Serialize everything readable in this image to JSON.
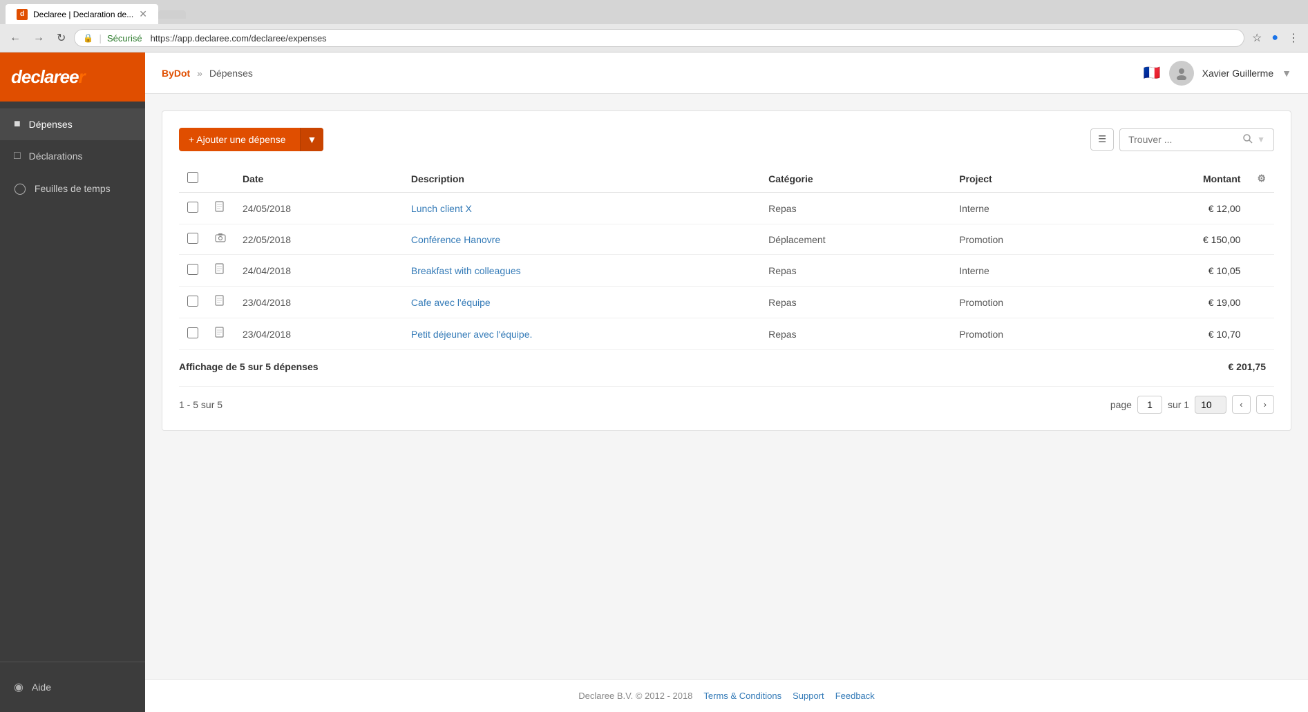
{
  "browser": {
    "tab_title": "Declaree | Declaration de...",
    "url": "https://app.declaree.com/declaree/expenses",
    "secure_label": "Sécurisé"
  },
  "sidebar": {
    "logo": "declaree",
    "items": [
      {
        "id": "depenses",
        "label": "Dépenses",
        "icon": "📄",
        "active": true
      },
      {
        "id": "declarations",
        "label": "Déclarations",
        "icon": "📋",
        "active": false
      },
      {
        "id": "feuilles",
        "label": "Feuilles de temps",
        "icon": "🕐",
        "active": false
      }
    ],
    "bottom_items": [
      {
        "id": "aide",
        "label": "Aide",
        "icon": "🌐"
      }
    ]
  },
  "header": {
    "org": "ByDot",
    "separator": "»",
    "page": "Dépenses",
    "user_name": "Xavier Guillerme",
    "flag": "🇫🇷"
  },
  "toolbar": {
    "add_button_label": "+ Ajouter une dépense",
    "search_placeholder": "Trouver ..."
  },
  "table": {
    "columns": [
      {
        "id": "checkbox",
        "label": ""
      },
      {
        "id": "receipt",
        "label": ""
      },
      {
        "id": "date",
        "label": "Date"
      },
      {
        "id": "description",
        "label": "Description"
      },
      {
        "id": "categorie",
        "label": "Catégorie"
      },
      {
        "id": "project",
        "label": "Project"
      },
      {
        "id": "montant",
        "label": "Montant"
      },
      {
        "id": "settings",
        "label": ""
      }
    ],
    "rows": [
      {
        "date": "24/05/2018",
        "description": "Lunch client X",
        "categorie": "Repas",
        "project": "Interne",
        "montant": "€ 12,00",
        "receipt_type": "doc"
      },
      {
        "date": "22/05/2018",
        "description": "Conférence Hanovre",
        "categorie": "Déplacement",
        "project": "Promotion",
        "montant": "€ 150,00",
        "receipt_type": "camera"
      },
      {
        "date": "24/04/2018",
        "description": "Breakfast with colleagues",
        "categorie": "Repas",
        "project": "Interne",
        "montant": "€ 10,05",
        "receipt_type": "doc"
      },
      {
        "date": "23/04/2018",
        "description": "Cafe avec l'équipe",
        "categorie": "Repas",
        "project": "Promotion",
        "montant": "€ 19,00",
        "receipt_type": "doc"
      },
      {
        "date": "23/04/2018",
        "description": "Petit déjeuner avec l'équipe.",
        "categorie": "Repas",
        "project": "Promotion",
        "montant": "€ 10,70",
        "receipt_type": "doc"
      }
    ],
    "summary": "Affichage de 5 sur 5 dépenses",
    "total": "€ 201,75"
  },
  "pagination": {
    "range": "1 - 5 sur 5",
    "page_label": "page",
    "current_page": "1",
    "total_pages_label": "sur 1",
    "per_page": "10"
  },
  "footer": {
    "copyright": "Declaree B.V. © 2012 - 2018",
    "terms_label": "Terms & Conditions",
    "support_label": "Support",
    "feedback_label": "Feedback"
  }
}
